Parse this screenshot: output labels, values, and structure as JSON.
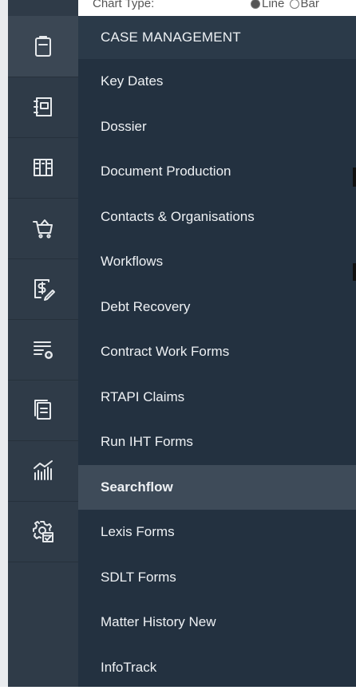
{
  "background": {
    "chart_type_label": "Chart Type:",
    "radio_line_label": "Line",
    "radio_bar_label": "Bar"
  },
  "rail": {
    "items": [
      {
        "icon": "clipboard-icon",
        "active": true
      },
      {
        "icon": "notebook-icon",
        "active": false
      },
      {
        "icon": "columns-icon",
        "active": false
      },
      {
        "icon": "basket-icon",
        "active": false
      },
      {
        "icon": "invoice-dollar-icon",
        "active": false
      },
      {
        "icon": "filter-settings-icon",
        "active": false
      },
      {
        "icon": "documents-icon",
        "active": false
      },
      {
        "icon": "chart-icon",
        "active": false
      },
      {
        "icon": "gear-calendar-icon",
        "active": false
      }
    ]
  },
  "menu": {
    "header": "CASE MANAGEMENT",
    "items": [
      {
        "label": "Key Dates",
        "selected": false
      },
      {
        "label": "Dossier",
        "selected": false
      },
      {
        "label": "Document Production",
        "selected": false
      },
      {
        "label": "Contacts & Organisations",
        "selected": false
      },
      {
        "label": "Workflows",
        "selected": false
      },
      {
        "label": "Debt Recovery",
        "selected": false
      },
      {
        "label": "Contract Work Forms",
        "selected": false
      },
      {
        "label": "RTAPI Claims",
        "selected": false
      },
      {
        "label": "Run IHT Forms",
        "selected": false
      },
      {
        "label": "Searchflow",
        "selected": true
      },
      {
        "label": "Lexis Forms",
        "selected": false
      },
      {
        "label": "SDLT Forms",
        "selected": false
      },
      {
        "label": "Matter History New",
        "selected": false
      },
      {
        "label": "InfoTrack",
        "selected": false
      }
    ]
  },
  "colors": {
    "rail_bg": "#2f3b48",
    "menu_bg": "#233140",
    "menu_header_bg": "#2b3a49",
    "selected_bg": "#3e4b59",
    "text": "#eef1f4"
  }
}
